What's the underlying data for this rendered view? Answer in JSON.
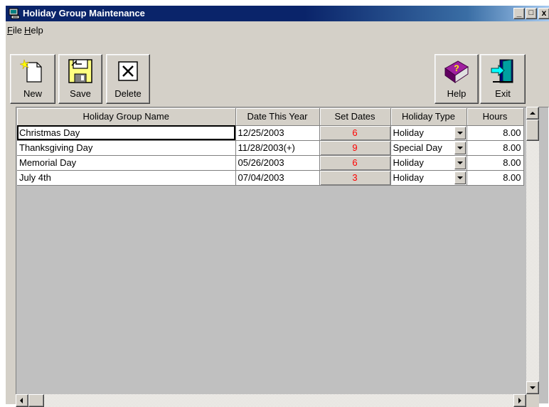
{
  "window": {
    "title": "Holiday Group Maintenance",
    "minimize_label": "_",
    "maximize_label": "□",
    "close_label": "x"
  },
  "menu": [
    {
      "label": "File"
    },
    {
      "label": "Help"
    }
  ],
  "toolbar": {
    "new_label": "New",
    "save_label": "Save",
    "delete_label": "Delete",
    "help_label": "Help",
    "exit_label": "Exit"
  },
  "grid": {
    "columns": [
      "Holiday Group Name",
      "Date This Year",
      "Set Dates",
      "Holiday Type",
      "Hours"
    ],
    "rows": [
      {
        "name": "Christmas Day",
        "date": "12/25/2003",
        "set_dates": "6",
        "type": "Holiday",
        "hours": "8.00"
      },
      {
        "name": "Thanksgiving Day",
        "date": "11/28/2003(+)",
        "set_dates": "9",
        "type": "Special Day",
        "hours": "8.00"
      },
      {
        "name": "Memorial Day",
        "date": "05/26/2003",
        "set_dates": "6",
        "type": "Holiday",
        "hours": "8.00"
      },
      {
        "name": "July 4th",
        "date": "07/04/2003",
        "set_dates": "3",
        "type": "Holiday",
        "hours": "8.00"
      }
    ]
  },
  "colors": {
    "title_bar": "#0a246a",
    "face": "#d4d0c8",
    "grid_bg": "#c0c0c0",
    "set_dates_text": "#ff0000"
  },
  "icons": {
    "app": "app-window-icon",
    "new": "new-document-icon",
    "save": "floppy-disk-icon",
    "delete": "delete-x-icon",
    "help": "help-book-icon",
    "exit": "exit-door-icon"
  }
}
